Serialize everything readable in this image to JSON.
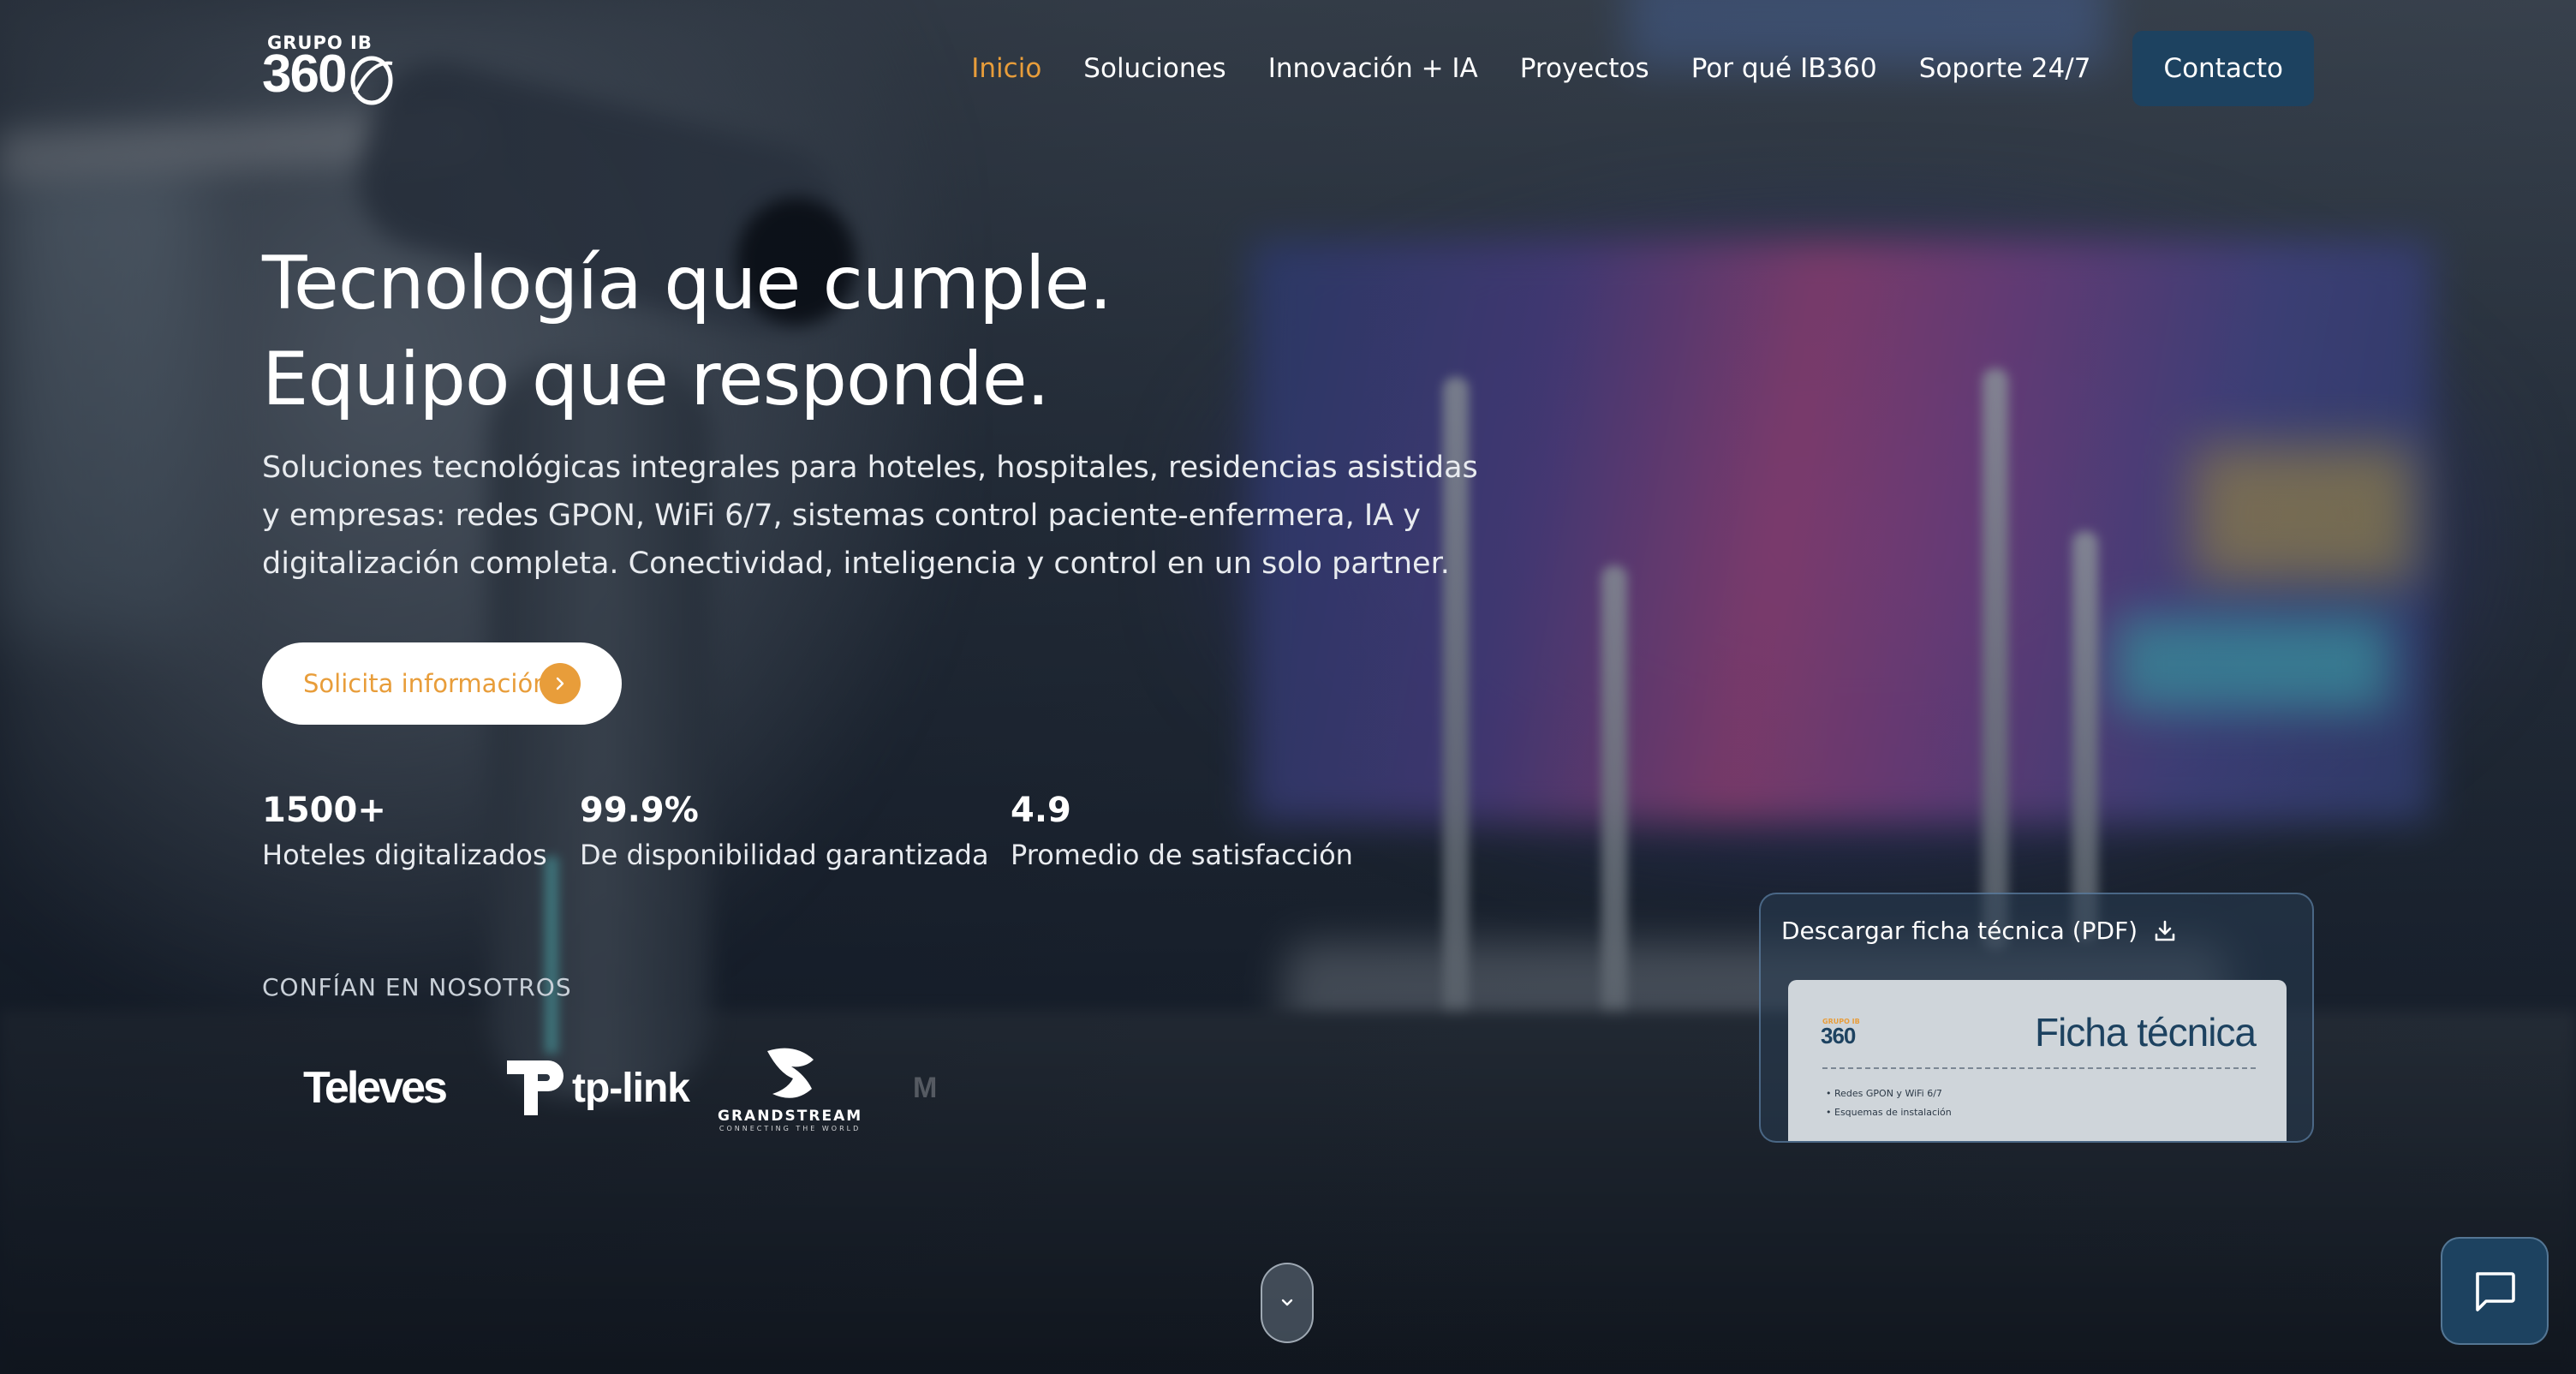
{
  "brand": {
    "logo_top": "GRUPO IB",
    "logo_number": "360"
  },
  "nav": {
    "items": [
      "Inicio",
      "Soluciones",
      "Innovación + IA",
      "Proyectos",
      "Por qué IB360",
      "Soporte 24/7"
    ],
    "active_index": 0,
    "contact_label": "Contacto"
  },
  "hero": {
    "title_line1": "Tecnología que cumple.",
    "title_line2": "Equipo que responde.",
    "subtitle": "Soluciones tecnológicas integrales para hoteles, hospitales, residencias asistidas y empresas: redes GPON, WiFi 6/7, sistemas control paciente-enfermera, IA y digitalización completa. Conectividad, inteligencia y control en un solo partner.",
    "cta_label": "Solicita información"
  },
  "stats": [
    {
      "value": "1500+",
      "label": "Hoteles digitalizados"
    },
    {
      "value": "99.9%",
      "label": "De disponibilidad garantizada"
    },
    {
      "value": "4.9",
      "label": "Promedio de satisfacción"
    }
  ],
  "trust": {
    "title": "CONFÍAN EN NOSOTROS",
    "partners": {
      "televes": "Televes",
      "tplink": "tp-link",
      "grandstream": "GRANDSTREAM",
      "grandstream_tagline": "CONNECTING THE WORLD",
      "faded": "M"
    }
  },
  "datasheet": {
    "link_label": "Descargar ficha técnica (PDF)",
    "preview": {
      "logo_top": "GRUPO IB",
      "logo_number": "360",
      "title": "Ficha técnica",
      "items": [
        "Redes GPON y WiFi 6/7",
        "Esquemas de instalación"
      ]
    }
  },
  "icons": {
    "cta": "chevron-right-icon",
    "datasheet": "download-icon",
    "scroll": "chevron-down-icon",
    "chat": "chat-bubble-icon"
  },
  "colors": {
    "accent": "#e89d3a",
    "brand_dark": "#1d4260",
    "text": "#ffffff"
  }
}
